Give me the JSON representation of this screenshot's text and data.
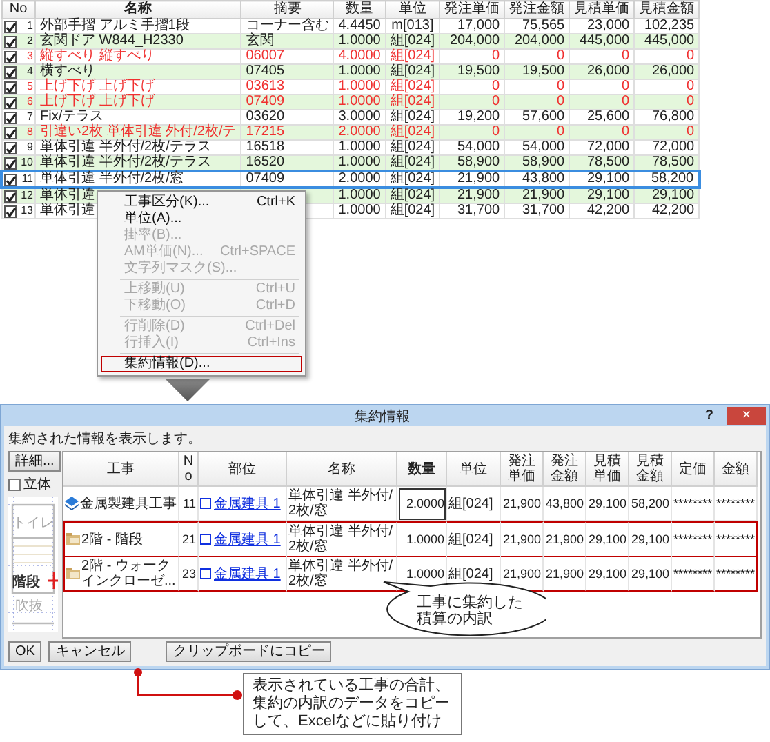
{
  "grid": {
    "columns": [
      "No",
      "名称",
      "摘要",
      "数量",
      "単位",
      "発注単価",
      "発注金額",
      "見積単価",
      "見積金額"
    ],
    "rows": [
      {
        "checked": true,
        "error": false,
        "selected": false,
        "cells": [
          "1",
          "外部手摺 アルミ手摺1段",
          "コーナー含む",
          "4.4450",
          "m[013]",
          "17,000",
          "75,565",
          "23,000",
          "102,235"
        ]
      },
      {
        "checked": true,
        "error": false,
        "selected": false,
        "cells": [
          "2",
          "玄関ドア W844_H2330",
          "玄関",
          "1.0000",
          "組[024]",
          "204,000",
          "204,000",
          "445,000",
          "445,000"
        ]
      },
      {
        "checked": true,
        "error": true,
        "selected": false,
        "cells": [
          "3",
          "縦すべり 縦すべり",
          "06007",
          "4.0000",
          "組[024]",
          "0",
          "0",
          "0",
          "0"
        ]
      },
      {
        "checked": true,
        "error": false,
        "selected": false,
        "cells": [
          "4",
          "横すべり",
          "07405",
          "1.0000",
          "組[024]",
          "19,500",
          "19,500",
          "26,000",
          "26,000"
        ]
      },
      {
        "checked": true,
        "error": true,
        "selected": false,
        "cells": [
          "5",
          "上げ下げ 上げ下げ",
          "03613",
          "1.0000",
          "組[024]",
          "0",
          "0",
          "0",
          "0"
        ]
      },
      {
        "checked": true,
        "error": true,
        "selected": false,
        "cells": [
          "6",
          "上げ下げ 上げ下げ",
          "07409",
          "1.0000",
          "組[024]",
          "0",
          "0",
          "0",
          "0"
        ]
      },
      {
        "checked": true,
        "error": false,
        "selected": false,
        "cells": [
          "7",
          "Fix/テラス",
          "03620",
          "3.0000",
          "組[024]",
          "19,200",
          "57,600",
          "25,600",
          "76,800"
        ]
      },
      {
        "checked": true,
        "error": true,
        "selected": false,
        "cells": [
          "8",
          "引違い2枚 単体引違 外付/2枚/テ",
          "17215",
          "2.0000",
          "組[024]",
          "0",
          "0",
          "0",
          "0"
        ]
      },
      {
        "checked": true,
        "error": false,
        "selected": false,
        "cells": [
          "9",
          "単体引違 半外付/2枚/テラス",
          "16518",
          "1.0000",
          "組[024]",
          "54,000",
          "54,000",
          "72,000",
          "72,000"
        ]
      },
      {
        "checked": true,
        "error": false,
        "selected": false,
        "cells": [
          "10",
          "単体引違 半外付/2枚/テラス",
          "16520",
          "1.0000",
          "組[024]",
          "58,900",
          "58,900",
          "78,500",
          "78,500"
        ]
      },
      {
        "checked": true,
        "error": false,
        "selected": true,
        "cells": [
          "11",
          "単体引違 半外付/2枚/窓",
          "07409",
          "2.0000",
          "組[024]",
          "21,900",
          "43,800",
          "29,100",
          "58,200"
        ]
      },
      {
        "checked": true,
        "error": false,
        "selected": false,
        "cells": [
          "12",
          "単体引違",
          null,
          "1.0000",
          "組[024]",
          "21,900",
          "21,900",
          "29,100",
          "29,100"
        ]
      },
      {
        "checked": true,
        "error": false,
        "selected": false,
        "cells": [
          "13",
          "単体引違",
          null,
          "1.0000",
          "組[024]",
          "31,700",
          "31,700",
          "42,200",
          "42,200"
        ]
      }
    ]
  },
  "context_menu": {
    "items": [
      {
        "kind": "item",
        "label": "工事区分(K)...",
        "shortcut": "Ctrl+K",
        "disabled": false,
        "annotated": false
      },
      {
        "kind": "item",
        "label": "単位(A)...",
        "disabled": false,
        "annotated": false
      },
      {
        "kind": "item",
        "label": "掛率(B)...",
        "disabled": true,
        "annotated": false
      },
      {
        "kind": "item",
        "label": "AM単価(N)...",
        "shortcut": "Ctrl+SPACE",
        "disabled": true,
        "annotated": false
      },
      {
        "kind": "item",
        "label": "文字列マスク(S)...",
        "disabled": true,
        "annotated": false
      },
      {
        "kind": "separator"
      },
      {
        "kind": "item",
        "label": "上移動(U)",
        "shortcut": "Ctrl+U",
        "disabled": true,
        "annotated": false
      },
      {
        "kind": "item",
        "label": "下移動(O)",
        "shortcut": "Ctrl+D",
        "disabled": true,
        "annotated": false
      },
      {
        "kind": "separator"
      },
      {
        "kind": "item",
        "label": "行削除(D)",
        "shortcut": "Ctrl+Del",
        "disabled": true,
        "annotated": false
      },
      {
        "kind": "item",
        "label": "行挿入(I)",
        "shortcut": "Ctrl+Ins",
        "disabled": true,
        "annotated": false
      },
      {
        "kind": "separator"
      },
      {
        "kind": "item",
        "label": "集約情報(D)...",
        "disabled": false,
        "annotated": true
      }
    ]
  },
  "dialog": {
    "title": "集約情報",
    "help": "?",
    "close": "×",
    "message": "集約された情報を表示します。",
    "detail_button": "詳細...",
    "solid_checkbox": {
      "label": "立体",
      "checked": false
    },
    "plan_labels": [
      "トイレ",
      "階段",
      "吹抜"
    ],
    "columns": [
      "工事",
      "No",
      "部位",
      "名称",
      "数量",
      "単位",
      "発注単価",
      "発注金額",
      "見積単価",
      "見積金額",
      "定価",
      "金額"
    ],
    "rows": [
      {
        "kind": "total",
        "annotated": false,
        "quantity_focused": true,
        "cells": [
          "金属製建具工事",
          "11",
          "金属建具 1",
          "単体引違 半外付/2枚/窓",
          "2.0000",
          "組[024]",
          "21,900",
          "43,800",
          "29,100",
          "58,200",
          "********",
          "********"
        ]
      },
      {
        "kind": "detail",
        "annotated": true,
        "quantity_focused": false,
        "cells": [
          "2階 - 階段",
          "21",
          "金属建具 1",
          "単体引違 半外付/2枚/窓",
          "1.0000",
          "組[024]",
          "21,900",
          "21,900",
          "29,100",
          "29,100",
          "********",
          "********"
        ]
      },
      {
        "kind": "detail",
        "annotated": true,
        "quantity_focused": false,
        "cells": [
          "2階 - ウォークインクローゼ...",
          "23",
          "金属建具 1",
          "単体引違 半外付/2枚/窓",
          "1.0000",
          "組[024]",
          "21,900",
          "21,900",
          "29,100",
          "29,100",
          "********",
          "********"
        ]
      }
    ],
    "callout": "工事に集約した積算の内訳",
    "buttons": [
      "OK",
      "キャンセル",
      "クリップボードにコピー"
    ]
  },
  "annotation": "表示されている工事の合計、集約の内訳のデータをコピーして、Excelなどに貼り付け"
}
